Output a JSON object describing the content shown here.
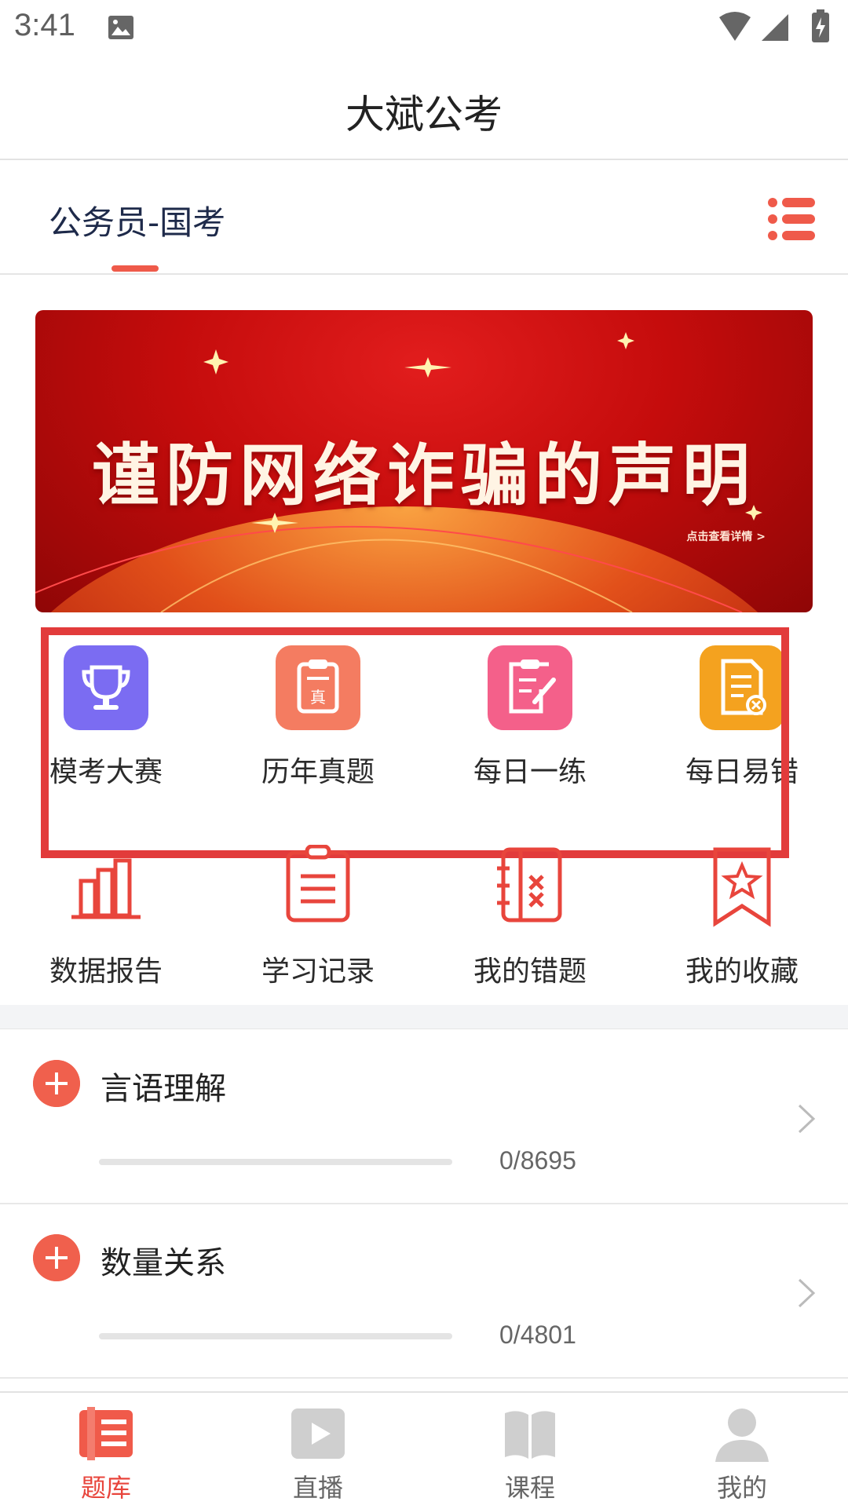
{
  "status_bar": {
    "time": "3:41"
  },
  "app": {
    "title": "大斌公考"
  },
  "category": {
    "label": "公务员-国考"
  },
  "banner": {
    "title": "谨防网络诈骗的声明",
    "link": "点击查看详情 >"
  },
  "feature_grid": [
    {
      "label": "模考大赛",
      "icon": "trophy-icon",
      "color": "#7b6cf2"
    },
    {
      "label": "历年真题",
      "icon": "clipboard-zhen-icon",
      "color": "#f47c61"
    },
    {
      "label": "每日一练",
      "icon": "clipboard-edit-icon",
      "color": "#f4608a"
    },
    {
      "label": "每日易错",
      "icon": "document-x-icon",
      "color": "#f4a21f"
    }
  ],
  "tools_grid": [
    {
      "label": "数据报告",
      "icon": "bar-chart-icon"
    },
    {
      "label": "学习记录",
      "icon": "clipboard-list-icon"
    },
    {
      "label": "我的错题",
      "icon": "wrong-questions-icon"
    },
    {
      "label": "我的收藏",
      "icon": "bookmark-star-icon"
    }
  ],
  "subjects": [
    {
      "title": "言语理解",
      "count": "0/8695",
      "progress": 0
    },
    {
      "title": "数量关系",
      "count": "0/4801",
      "progress": 0
    }
  ],
  "tabs": [
    {
      "label": "题库",
      "icon": "question-bank-icon",
      "active": true
    },
    {
      "label": "直播",
      "icon": "play-icon",
      "active": false
    },
    {
      "label": "课程",
      "icon": "book-icon",
      "active": false
    },
    {
      "label": "我的",
      "icon": "person-icon",
      "active": false
    }
  ],
  "colors": {
    "accent": "#e8453c",
    "highlight": "#e23b3b"
  }
}
